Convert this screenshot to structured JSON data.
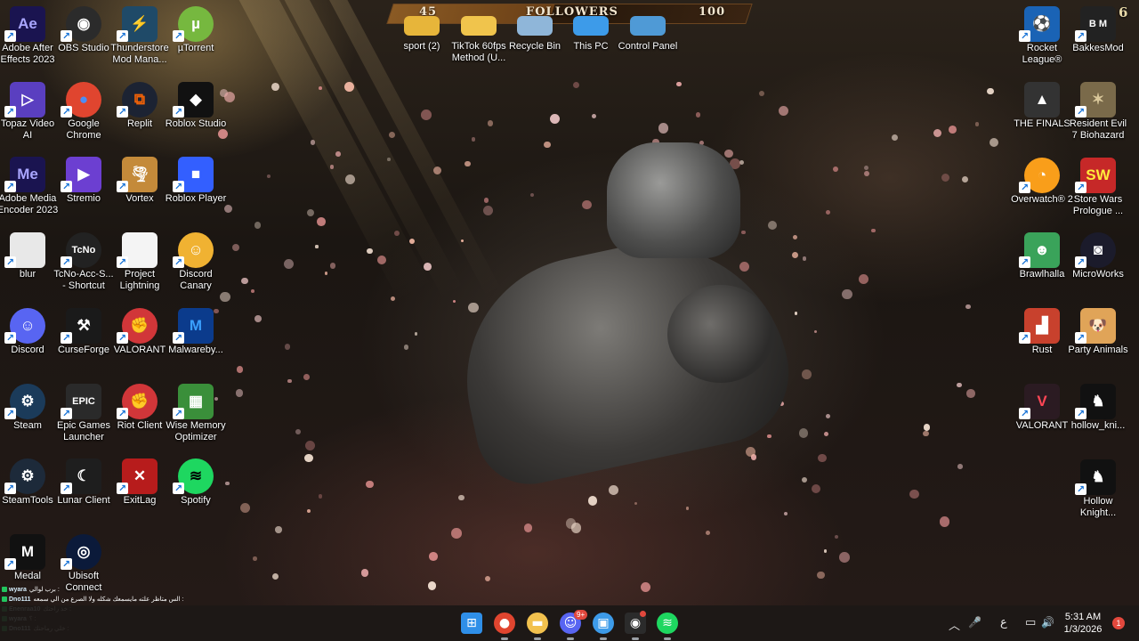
{
  "follower_goal": {
    "current": "45",
    "label": "FOLLOWERS",
    "target": "100",
    "progress": 0.45
  },
  "corner_badge": "6",
  "desktop_icons": [
    {
      "label": "Adobe After Effects 2023",
      "icon": "after-effects-icon",
      "color": "#1a1450",
      "glyph": "Ae",
      "fg": "#a9a6ff"
    },
    {
      "label": "OBS Studio",
      "icon": "obs-icon",
      "color": "#2b2b2b",
      "glyph": "◉",
      "fg": "#ffffff",
      "round": true
    },
    {
      "label": "Thunderstore Mod Mana...",
      "icon": "thunderstore-icon",
      "color": "#1f4a68",
      "glyph": "⚡",
      "fg": "#7fd0ff"
    },
    {
      "label": "µTorrent",
      "icon": "utorrent-icon",
      "color": "#76b83f",
      "glyph": "µ",
      "fg": "#ffffff",
      "round": true
    },
    {
      "label": "Topaz Video AI",
      "icon": "topaz-icon",
      "color": "#5a3fc0",
      "glyph": "▷",
      "fg": "#ffffff"
    },
    {
      "label": "Google Chrome",
      "icon": "chrome-icon",
      "color": "#e0452f",
      "glyph": "●",
      "fg": "#4d8df5",
      "round": true
    },
    {
      "label": "Replit",
      "icon": "replit-icon",
      "color": "#1c2333",
      "glyph": "⧉",
      "fg": "#f26207",
      "round": true
    },
    {
      "label": "Roblox Studio",
      "icon": "roblox-studio-icon",
      "color": "#111111",
      "glyph": "◆",
      "fg": "#ffffff"
    },
    {
      "label": "Adobe Media Encoder 2023",
      "icon": "media-encoder-icon",
      "color": "#1a1450",
      "glyph": "Me",
      "fg": "#a9a6ff"
    },
    {
      "label": "Stremio",
      "icon": "stremio-icon",
      "color": "#6c3fd1",
      "glyph": "▶",
      "fg": "#ffffff"
    },
    {
      "label": "Vortex",
      "icon": "vortex-icon",
      "color": "#c48a3a",
      "glyph": "🌪",
      "fg": "#ffffff"
    },
    {
      "label": "Roblox Player",
      "icon": "roblox-player-icon",
      "color": "#335fff",
      "glyph": "■",
      "fg": "#ffffff"
    },
    {
      "label": "blur",
      "icon": "blur-file-icon",
      "color": "#e8e8e8",
      "glyph": "",
      "fg": "#000000"
    },
    {
      "label": "TcNo-Acc-S... - Shortcut",
      "icon": "tcno-icon",
      "color": "#222222",
      "glyph": "TcNo",
      "fg": "#ffffff",
      "round": true
    },
    {
      "label": "Project Lightning",
      "icon": "document-icon",
      "color": "#f4f4f4",
      "glyph": "",
      "fg": "#000000"
    },
    {
      "label": "Discord Canary",
      "icon": "discord-canary-icon",
      "color": "#f0b232",
      "glyph": "☺",
      "fg": "#ffffff",
      "round": true
    },
    {
      "label": "Discord",
      "icon": "discord-icon",
      "color": "#5865f2",
      "glyph": "☺",
      "fg": "#ffffff",
      "round": true
    },
    {
      "label": "CurseForge",
      "icon": "curseforge-icon",
      "color": "#1a1a1a",
      "glyph": "⚒",
      "fg": "#ffffff"
    },
    {
      "label": "VALORANT",
      "icon": "riot-valorant-icon",
      "color": "#d13639",
      "glyph": "✊",
      "fg": "#ffffff",
      "round": true
    },
    {
      "label": "Malwareby...",
      "icon": "malwarebytes-icon",
      "color": "#0b3b8c",
      "glyph": "M",
      "fg": "#3aa0ff"
    },
    {
      "label": "Steam",
      "icon": "steam-icon",
      "color": "#1b3b5a",
      "glyph": "⚙",
      "fg": "#ffffff",
      "round": true
    },
    {
      "label": "Epic Games Launcher",
      "icon": "epic-games-icon",
      "color": "#2a2a2a",
      "glyph": "EPIC",
      "fg": "#ffffff"
    },
    {
      "label": "Riot Client",
      "icon": "riot-client-icon",
      "color": "#d13639",
      "glyph": "✊",
      "fg": "#ffffff",
      "round": true
    },
    {
      "label": "Wise Memory Optimizer",
      "icon": "wise-memory-icon",
      "color": "#3a8f3a",
      "glyph": "▦",
      "fg": "#ffffff"
    },
    {
      "label": "SteamTools",
      "icon": "steamtools-icon",
      "color": "#1d2a3a",
      "glyph": "⚙",
      "fg": "#ffffff",
      "round": true
    },
    {
      "label": "Lunar Client",
      "icon": "lunar-client-icon",
      "color": "#1e1e1e",
      "glyph": "☾",
      "fg": "#ffffff"
    },
    {
      "label": "ExitLag",
      "icon": "exitlag-icon",
      "color": "#b71c1c",
      "glyph": "✕",
      "fg": "#ffffff"
    },
    {
      "label": "Spotify",
      "icon": "spotify-icon",
      "color": "#1ed760",
      "glyph": "≋",
      "fg": "#000000",
      "round": true
    },
    {
      "label": "Medal",
      "icon": "medal-icon",
      "color": "#111111",
      "glyph": "M",
      "fg": "#ffffff"
    },
    {
      "label": "Ubisoft Connect",
      "icon": "ubisoft-icon",
      "color": "#0b1a3a",
      "glyph": "◎",
      "fg": "#ffffff",
      "round": true
    }
  ],
  "top_icons": [
    {
      "label": "sport (2)",
      "icon": "folder-icon",
      "color": "#e7b53a"
    },
    {
      "label": "TikTok 60fps Method (U...",
      "icon": "folder-icon",
      "color": "#f0c44c"
    },
    {
      "label": "Recycle Bin",
      "icon": "recycle-bin-icon",
      "color": "#8fb6d9"
    },
    {
      "label": "This PC",
      "icon": "this-pc-icon",
      "color": "#3d9be9"
    },
    {
      "label": "Control Panel",
      "icon": "control-panel-icon",
      "color": "#4f9ad6"
    }
  ],
  "right_icons": [
    {
      "label": "Rocket League®",
      "icon": "rocket-league-icon",
      "color": "#1a63b5",
      "glyph": "⚽",
      "fg": "#ffffff"
    },
    {
      "label": "BakkesMod",
      "icon": "bakkesmod-icon",
      "color": "#222222",
      "glyph": "B M",
      "fg": "#ffffff"
    },
    {
      "label": "THE FINALS",
      "icon": "the-finals-icon",
      "color": "#333333",
      "glyph": "▲",
      "fg": "#ffffff"
    },
    {
      "label": "Resident Evil 7 Biohazard",
      "icon": "resident-evil-icon",
      "color": "#7a6a4a",
      "glyph": "✶",
      "fg": "#d9c79a"
    },
    {
      "label": "Overwatch® 2",
      "icon": "overwatch-icon",
      "color": "#f99e1a",
      "glyph": "◔",
      "fg": "#ffffff",
      "round": true
    },
    {
      "label": "Store Wars Prologue ...",
      "icon": "store-wars-icon",
      "color": "#c62828",
      "glyph": "SW",
      "fg": "#ffeb3b"
    },
    {
      "label": "Brawlhalla",
      "icon": "brawlhalla-icon",
      "color": "#3aa35a",
      "glyph": "☻",
      "fg": "#ffffff"
    },
    {
      "label": "MicroWorks",
      "icon": "microworks-icon",
      "color": "#1b1b2b",
      "glyph": "◙",
      "fg": "#ffffff",
      "round": true
    },
    {
      "label": "Rust",
      "icon": "rust-icon",
      "color": "#c8412d",
      "glyph": "▟",
      "fg": "#ffffff"
    },
    {
      "label": "Party Animals",
      "icon": "party-animals-icon",
      "color": "#e0a458",
      "glyph": "🐶",
      "fg": "#ffffff"
    },
    {
      "label": "VALORANT",
      "icon": "valorant-icon",
      "color": "#2b1b22",
      "glyph": "V",
      "fg": "#ff4655"
    },
    {
      "label": "hollow_kni...",
      "icon": "hollow-knight-file-icon",
      "color": "#111111",
      "glyph": "♞",
      "fg": "#ffffff"
    },
    {
      "label": "Hollow Knight...",
      "icon": "hollow-knight-icon",
      "color": "#111111",
      "glyph": "♞",
      "fg": "#ffffff"
    }
  ],
  "chat_messages": [
    {
      "user": "wyara",
      "text": "برب لوالي :"
    },
    {
      "user": "Dno111",
      "text": "الس متاظر علته مايسمعك شكله ولا الصرع من الي سمعه :"
    },
    {
      "user": "Enenraa10",
      "text": "خذ راحتك :"
    },
    {
      "user": "wyara",
      "text": "؟ :"
    },
    {
      "user": "Dno111",
      "text": "خلي رماحتك :"
    }
  ],
  "taskbar": {
    "apps": [
      {
        "name": "start-icon",
        "color": "#2f8fe8",
        "glyph": "⊞"
      },
      {
        "name": "chrome-taskbar-icon",
        "color": "#e0452f",
        "glyph": "●"
      },
      {
        "name": "file-explorer-icon",
        "color": "#f2c14e",
        "glyph": "▬"
      },
      {
        "name": "discord-taskbar-icon",
        "color": "#5865f2",
        "glyph": "☺",
        "badge": "9+"
      },
      {
        "name": "photos-taskbar-icon",
        "color": "#3d9be9",
        "glyph": "▣"
      },
      {
        "name": "obs-taskbar-icon",
        "color": "#2b2b2b",
        "glyph": "◉",
        "dot": true
      },
      {
        "name": "spotify-taskbar-icon",
        "color": "#1ed760",
        "glyph": "≋"
      }
    ],
    "tray": {
      "chevron": "︿",
      "mic": "🎤",
      "ime": "ع",
      "network": "▭",
      "volume": "🔊",
      "battery": "▮"
    },
    "time": "5:31 AM",
    "date": "1/3/2026",
    "notifications": "1"
  }
}
